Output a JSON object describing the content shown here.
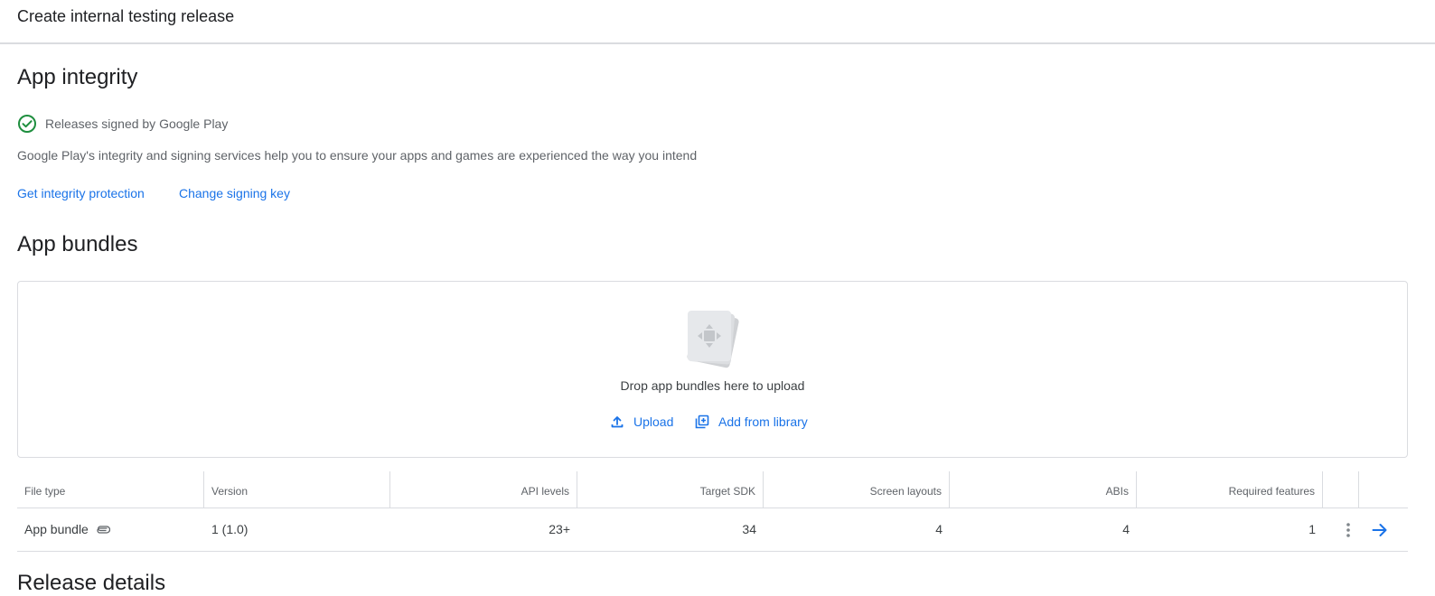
{
  "header": {
    "title": "Create internal testing release"
  },
  "app_integrity": {
    "heading": "App integrity",
    "status_label": "Releases signed by Google Play",
    "description": "Google Play's integrity and signing services help you to ensure your apps and games are experienced the way you intend",
    "links": {
      "get_protection": "Get integrity protection",
      "change_key": "Change signing key"
    },
    "status_color": "#1e8e3e"
  },
  "app_bundles": {
    "heading": "App bundles",
    "dropzone_text": "Drop app bundles here to upload",
    "upload_label": "Upload",
    "library_label": "Add from library",
    "table": {
      "columns": [
        "File type",
        "Version",
        "API levels",
        "Target SDK",
        "Screen layouts",
        "ABIs",
        "Required features"
      ],
      "rows": [
        {
          "file_type": "App bundle",
          "version": "1 (1.0)",
          "api_levels": "23+",
          "target_sdk": "34",
          "screen_layouts": "4",
          "abis": "4",
          "required_features": "1"
        }
      ]
    }
  },
  "next_section": {
    "heading": "Release details"
  },
  "colors": {
    "accent": "#1a73e8",
    "border": "#dadce0",
    "text_secondary": "#5f6368"
  }
}
